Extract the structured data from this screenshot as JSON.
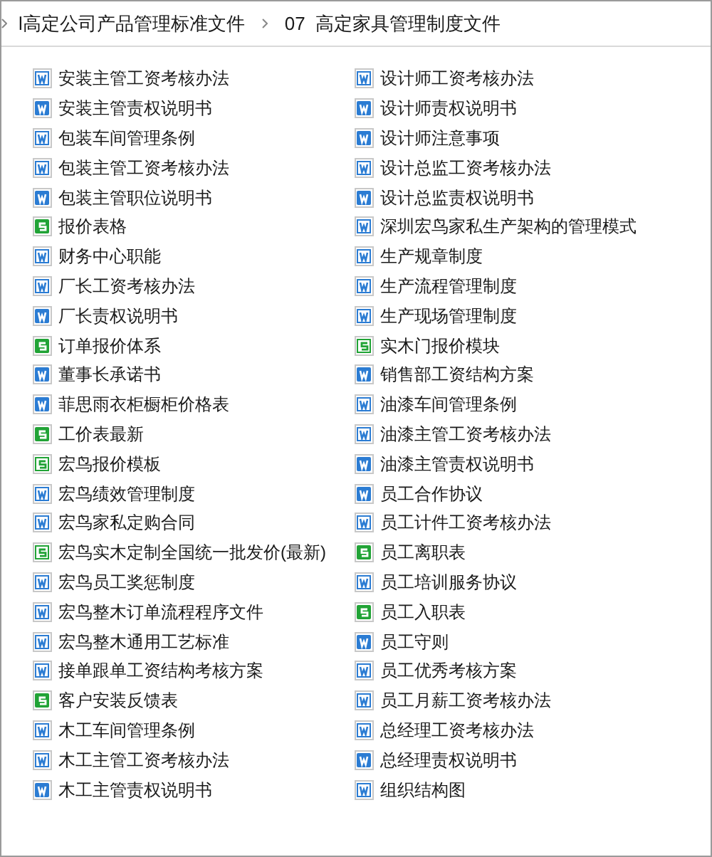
{
  "breadcrumb": [
    {
      "label": "l高定公司产品管理标准文件"
    },
    {
      "label": "07  高定家具管理制度文件"
    }
  ],
  "files": [
    {
      "name": "安装主管工资考核办法",
      "kind": "doc"
    },
    {
      "name": "安装主管责权说明书",
      "kind": "docx"
    },
    {
      "name": "包装车间管理条例",
      "kind": "doc"
    },
    {
      "name": "包装主管工资考核办法",
      "kind": "doc"
    },
    {
      "name": "包装主管职位说明书",
      "kind": "docx"
    },
    {
      "name": "报价表格",
      "kind": "xlsx"
    },
    {
      "name": "财务中心职能",
      "kind": "doc"
    },
    {
      "name": "厂长工资考核办法",
      "kind": "doc"
    },
    {
      "name": "厂长责权说明书",
      "kind": "docx"
    },
    {
      "name": "订单报价体系",
      "kind": "xlsx"
    },
    {
      "name": "董事长承诺书",
      "kind": "docx"
    },
    {
      "name": "菲思雨衣柜橱柜价格表",
      "kind": "docx"
    },
    {
      "name": "工价表最新",
      "kind": "xlsx"
    },
    {
      "name": "宏鸟报价模板",
      "kind": "xls"
    },
    {
      "name": "宏鸟绩效管理制度",
      "kind": "doc"
    },
    {
      "name": "宏鸟家私定购合同",
      "kind": "doc"
    },
    {
      "name": "宏鸟实木定制全国统一批发价(最新)",
      "kind": "xls"
    },
    {
      "name": "宏鸟员工奖惩制度",
      "kind": "doc"
    },
    {
      "name": "宏鸟整木订单流程程序文件",
      "kind": "doc"
    },
    {
      "name": "宏鸟整木通用工艺标准",
      "kind": "doc"
    },
    {
      "name": "接单跟单工资结构考核方案",
      "kind": "doc"
    },
    {
      "name": "客户安装反馈表",
      "kind": "xlsx"
    },
    {
      "name": "木工车间管理条例",
      "kind": "doc"
    },
    {
      "name": "木工主管工资考核办法",
      "kind": "doc"
    },
    {
      "name": "木工主管责权说明书",
      "kind": "docx"
    },
    {
      "name": "设计师工资考核办法",
      "kind": "doc"
    },
    {
      "name": "设计师责权说明书",
      "kind": "docx"
    },
    {
      "name": "设计师注意事项",
      "kind": "docx"
    },
    {
      "name": "设计总监工资考核办法",
      "kind": "doc"
    },
    {
      "name": "设计总监责权说明书",
      "kind": "docx"
    },
    {
      "name": "深圳宏鸟家私生产架构的管理模式",
      "kind": "doc"
    },
    {
      "name": "生产规章制度",
      "kind": "doc"
    },
    {
      "name": "生产流程管理制度",
      "kind": "doc"
    },
    {
      "name": "生产现场管理制度",
      "kind": "doc"
    },
    {
      "name": "实木门报价模块",
      "kind": "xls"
    },
    {
      "name": "销售部工资结构方案",
      "kind": "docx"
    },
    {
      "name": "油漆车间管理条例",
      "kind": "doc"
    },
    {
      "name": "油漆主管工资考核办法",
      "kind": "doc"
    },
    {
      "name": "油漆主管责权说明书",
      "kind": "docx"
    },
    {
      "name": "员工合作协议",
      "kind": "docx"
    },
    {
      "name": "员工计件工资考核办法",
      "kind": "doc"
    },
    {
      "name": "员工离职表",
      "kind": "xlsx"
    },
    {
      "name": "员工培训服务协议",
      "kind": "doc"
    },
    {
      "name": "员工入职表",
      "kind": "xlsx"
    },
    {
      "name": "员工守则",
      "kind": "docx"
    },
    {
      "name": "员工优秀考核方案",
      "kind": "doc"
    },
    {
      "name": "员工月薪工资考核办法",
      "kind": "doc"
    },
    {
      "name": "总经理工资考核办法",
      "kind": "doc"
    },
    {
      "name": "总经理责权说明书",
      "kind": "docx"
    },
    {
      "name": "组织结构图",
      "kind": "doc"
    }
  ]
}
